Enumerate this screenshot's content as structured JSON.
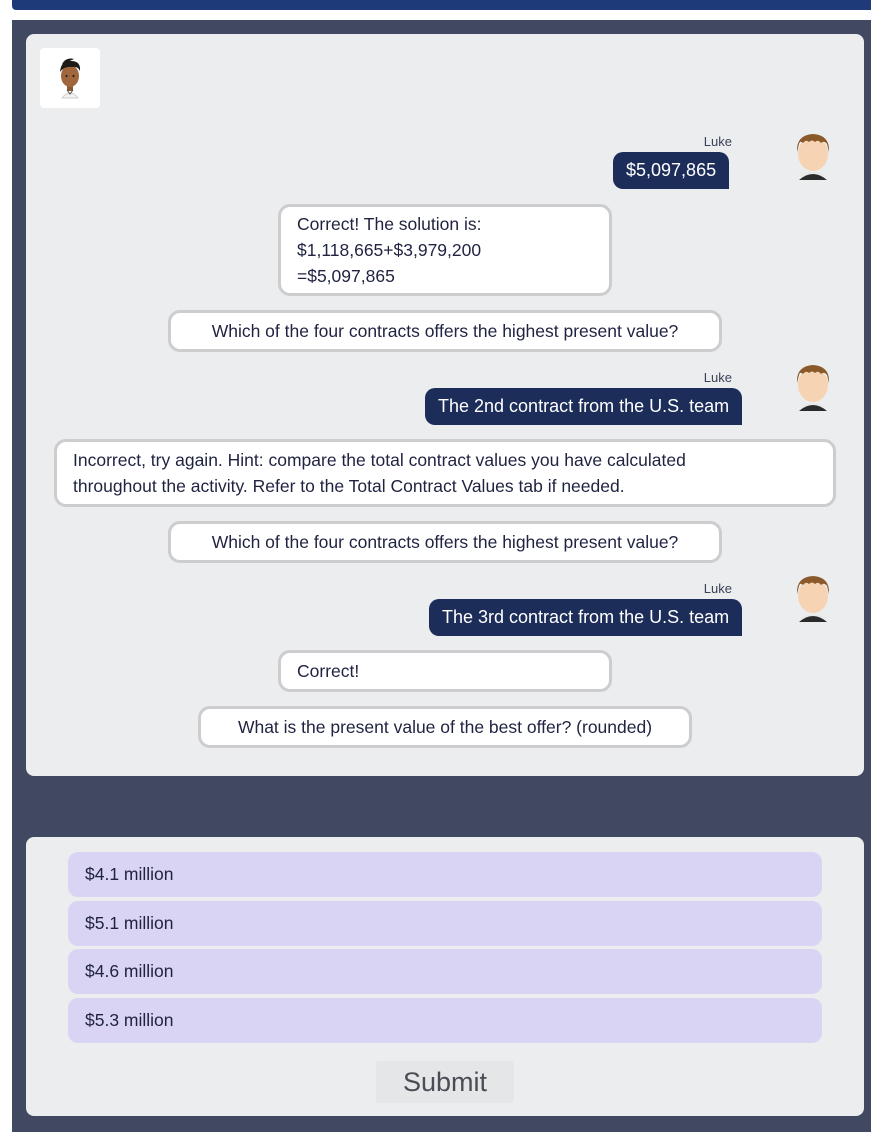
{
  "chat": {
    "messages": [
      {
        "sender": "Luke",
        "text": "$5,097,865"
      },
      {
        "lines": [
          "Correct! The solution is:",
          "$1,118,665+$3,979,200",
          "=$5,097,865"
        ]
      },
      {
        "text": "Which of the four contracts offers the highest present value?"
      },
      {
        "sender": "Luke",
        "text": "The 2nd contract from the U.S. team"
      },
      {
        "lines": [
          "Incorrect, try again. Hint: compare the total contract values you have calculated",
          "throughout the activity. Refer to the Total Contract Values tab if needed."
        ]
      },
      {
        "text": "Which of the four contracts offers the highest present value?"
      },
      {
        "sender": "Luke",
        "text": "The 3rd contract from the U.S. team"
      },
      {
        "text": "Correct!"
      },
      {
        "text": "What is the present value of the best offer? (rounded)"
      }
    ]
  },
  "answers": {
    "options": [
      "$4.1 million",
      "$5.1 million",
      "$4.6 million",
      "$5.3 million"
    ],
    "submit_label": "Submit"
  },
  "colors": {
    "frame": "#404862",
    "panel": "#ecedef",
    "user_bubble": "#1d2d5a",
    "option": "#d9d4f3",
    "top_bar": "#1e3a78"
  },
  "icons": {
    "bot": "bot-avatar-icon",
    "user": "user-avatar-icon"
  }
}
